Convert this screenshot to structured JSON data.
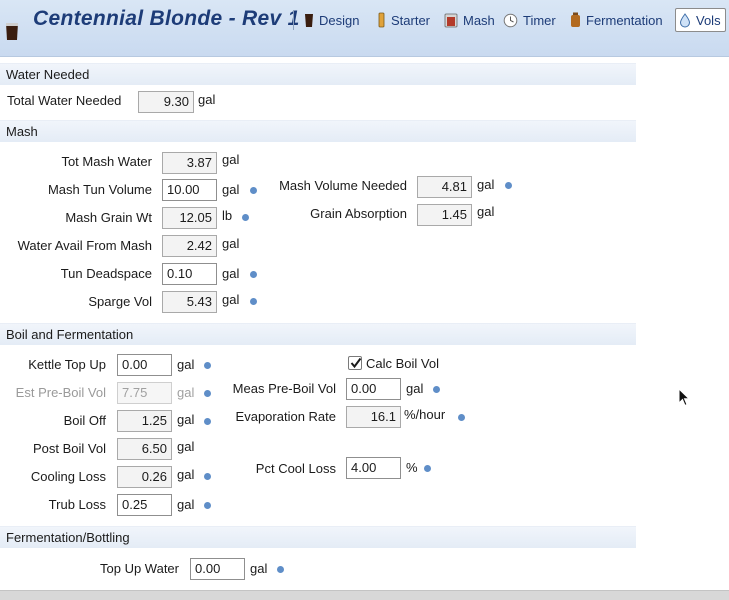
{
  "header": {
    "title": "Centennial Blonde - Rev 1",
    "tabs": [
      {
        "label": "Design",
        "icon": "pint-glass-icon"
      },
      {
        "label": "Starter",
        "icon": "flask-icon"
      },
      {
        "label": "Mash",
        "icon": "mash-tun-icon"
      },
      {
        "label": "Timer",
        "icon": "clock-icon"
      },
      {
        "label": "Fermentation",
        "icon": "fermenter-icon"
      },
      {
        "label": "Vols",
        "icon": "water-drop-icon"
      }
    ],
    "active_tab": "Vols"
  },
  "water": {
    "header": "Water Needed",
    "total_label": "Total Water Needed",
    "total_value": "9.30",
    "total_unit": "gal"
  },
  "mash": {
    "header": "Mash",
    "tot_mash_water": {
      "label": "Tot Mash Water",
      "value": "3.87",
      "unit": "gal"
    },
    "mash_tun_volume": {
      "label": "Mash Tun Volume",
      "value": "10.00",
      "unit": "gal"
    },
    "mash_grain_wt": {
      "label": "Mash Grain Wt",
      "value": "12.05",
      "unit": "lb"
    },
    "water_avail": {
      "label": "Water Avail From Mash",
      "value": "2.42",
      "unit": "gal"
    },
    "tun_deadspace": {
      "label": "Tun Deadspace",
      "value": "0.10",
      "unit": "gal"
    },
    "sparge_vol": {
      "label": "Sparge Vol",
      "value": "5.43",
      "unit": "gal"
    },
    "mash_volume_needed": {
      "label": "Mash Volume Needed",
      "value": "4.81",
      "unit": "gal"
    },
    "grain_absorption": {
      "label": "Grain Absorption",
      "value": "1.45",
      "unit": "gal"
    }
  },
  "boil": {
    "header": "Boil and Fermentation",
    "kettle_top_up": {
      "label": "Kettle Top Up",
      "value": "0.00",
      "unit": "gal"
    },
    "est_pre_boil": {
      "label": "Est Pre-Boil Vol",
      "value": "7.75",
      "unit": "gal"
    },
    "boil_off": {
      "label": "Boil Off",
      "value": "1.25",
      "unit": "gal"
    },
    "post_boil": {
      "label": "Post Boil Vol",
      "value": "6.50",
      "unit": "gal"
    },
    "cooling_loss": {
      "label": "Cooling Loss",
      "value": "0.26",
      "unit": "gal"
    },
    "trub_loss": {
      "label": "Trub Loss",
      "value": "0.25",
      "unit": "gal"
    },
    "calc_boil_vol": {
      "label": "Calc Boil Vol",
      "checked": true
    },
    "meas_pre_boil": {
      "label": "Meas Pre-Boil Vol",
      "value": "0.00",
      "unit": "gal"
    },
    "evaporation_rate": {
      "label": "Evaporation Rate",
      "value": "16.1",
      "unit": "%/hour"
    },
    "pct_cool_loss": {
      "label": "Pct Cool Loss",
      "value": "4.00",
      "unit": "%"
    }
  },
  "fermentation": {
    "header": "Fermentation/Bottling",
    "top_up_water": {
      "label": "Top Up Water",
      "value": "0.00",
      "unit": "gal"
    }
  },
  "colors": {
    "title": "#1d3c78",
    "info_dot": "#5f8ec8",
    "header_bg": "#c9daf0"
  }
}
